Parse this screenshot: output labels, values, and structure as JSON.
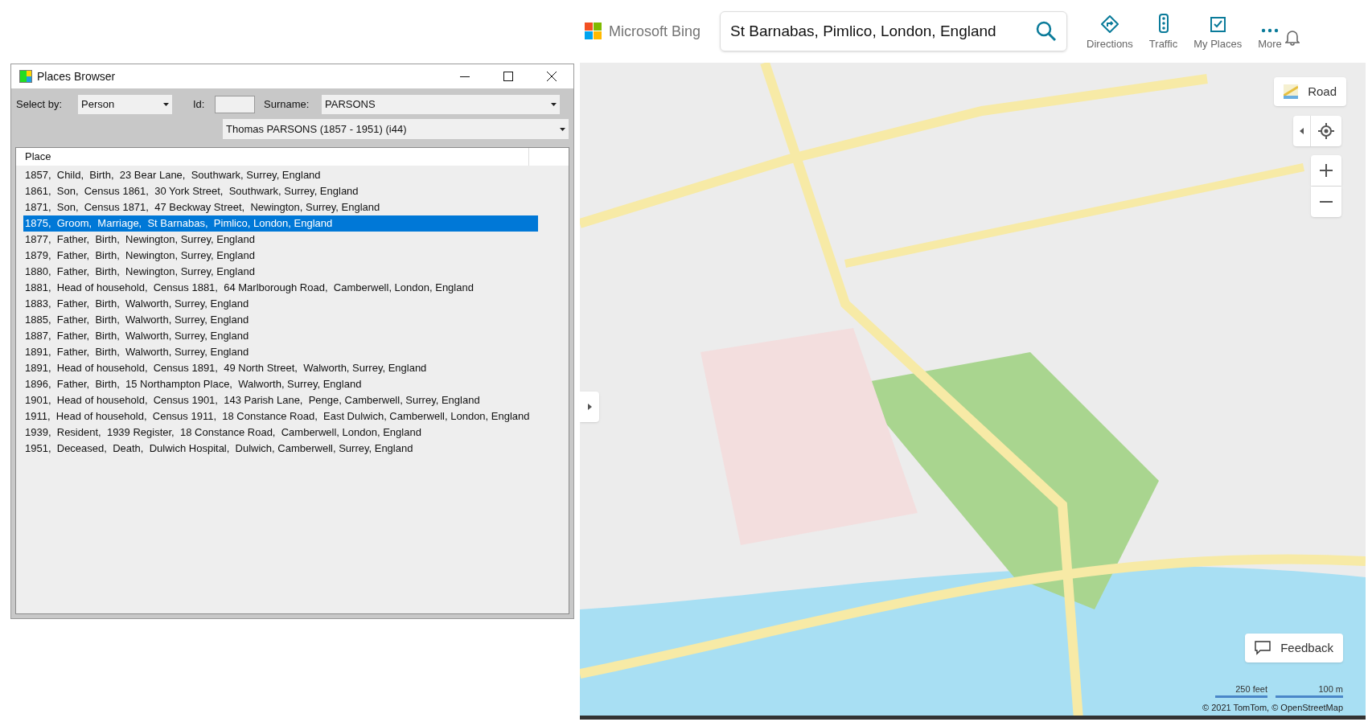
{
  "header": {
    "logo": "Microsoft Bing",
    "search": {
      "value": "St Barnabas, Pimlico, London, England"
    },
    "nav": [
      {
        "kind": "directions",
        "label": "Directions"
      },
      {
        "kind": "traffic",
        "label": "Traffic"
      },
      {
        "kind": "places",
        "label": "My Places"
      },
      {
        "kind": "more",
        "label": "More"
      }
    ]
  },
  "window": {
    "title": "Places Browser",
    "select_by": {
      "label": "Select by:",
      "value": "Person"
    },
    "id": {
      "label": "Id:"
    },
    "surname": {
      "label": "Surname:",
      "value": "PARSONS"
    },
    "person": {
      "value": "Thomas PARSONS  (1857 - 1951)  (i44)"
    },
    "table": {
      "columns": [
        "Place"
      ],
      "rows": [
        {
          "text": "1857,  Child,  Birth,  23 Bear Lane,  Southwark, Surrey, England",
          "selected": false
        },
        {
          "text": "1861,  Son,  Census 1861,  30 York Street,  Southwark, Surrey, England",
          "selected": false
        },
        {
          "text": "1871,  Son,  Census 1871,  47 Beckway Street,  Newington, Surrey, England",
          "selected": false
        },
        {
          "text": "1875,  Groom,  Marriage,  St Barnabas,  Pimlico, London, England",
          "selected": true
        },
        {
          "text": "1877,  Father,  Birth,  Newington, Surrey, England",
          "selected": false
        },
        {
          "text": "1879,  Father,  Birth,  Newington, Surrey, England",
          "selected": false
        },
        {
          "text": "1880,  Father,  Birth,  Newington, Surrey, England",
          "selected": false
        },
        {
          "text": "1881,  Head of household,  Census 1881,  64 Marlborough Road,  Camberwell, London, England",
          "selected": false
        },
        {
          "text": "1883,  Father,  Birth,  Walworth, Surrey, England",
          "selected": false
        },
        {
          "text": "1885,  Father,  Birth,  Walworth, Surrey, England",
          "selected": false
        },
        {
          "text": "1887,  Father,  Birth,  Walworth, Surrey, England",
          "selected": false
        },
        {
          "text": "1891,  Father,  Birth,  Walworth, Surrey, England",
          "selected": false
        },
        {
          "text": "1891,  Head of household,  Census 1891,  49 North Street,  Walworth, Surrey, England",
          "selected": false
        },
        {
          "text": "1896,  Father,  Birth,  15 Northampton Place,  Walworth, Surrey, England",
          "selected": false
        },
        {
          "text": "1901,  Head of household,  Census 1901,  143 Parish Lane,  Penge, Camberwell, Surrey, England",
          "selected": false
        },
        {
          "text": "1911,  Head of household,  Census 1911,  18 Constance Road,  East Dulwich, Camberwell, London, England",
          "selected": false
        },
        {
          "text": "1939,  Resident,  1939 Register,  18 Constance Road,  Camberwell, London, England",
          "selected": false
        },
        {
          "text": "1951,  Deceased,  Death,  Dulwich Hospital,  Dulwich, Camberwell, Surrey, England",
          "selected": false
        }
      ]
    }
  },
  "map": {
    "style_button": "Road",
    "feedback": "Feedback",
    "scale": [
      "250 feet",
      "100 m"
    ],
    "copyright": "© 2021 TomTom, © OpenStreetMap"
  }
}
